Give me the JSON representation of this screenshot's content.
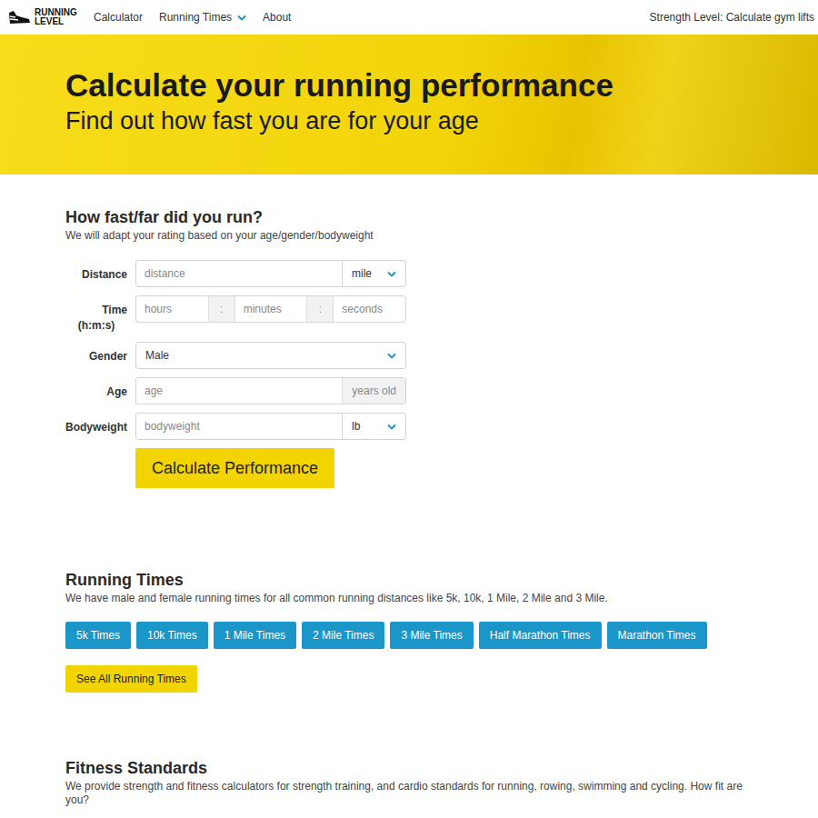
{
  "nav": {
    "logo": {
      "line1": "RUNNING",
      "line2": "LEVEL"
    },
    "links": [
      {
        "label": "Calculator",
        "dropdown": false
      },
      {
        "label": "Running Times",
        "dropdown": true
      },
      {
        "label": "About",
        "dropdown": false
      }
    ],
    "right_link": "Strength Level: Calculate gym lifts"
  },
  "hero": {
    "title": "Calculate your running performance",
    "subtitle": "Find out how fast you are for your age"
  },
  "calculator": {
    "title": "How fast/far did you run?",
    "subtitle": "We will adapt your rating based on your age/gender/bodyweight",
    "fields": [
      {
        "kind": "unit",
        "label": "Distance",
        "placeholder": "distance",
        "unit": "mile"
      },
      {
        "kind": "time",
        "label": "Time",
        "sublabel": "(h:m:s)",
        "parts": [
          "hours",
          "minutes",
          "seconds"
        ],
        "separator": ":"
      },
      {
        "kind": "select",
        "label": "Gender",
        "value": "Male"
      },
      {
        "kind": "addon",
        "label": "Age",
        "placeholder": "age",
        "addon": "years old"
      },
      {
        "kind": "unit",
        "label": "Bodyweight",
        "placeholder": "bodyweight",
        "unit": "lb"
      }
    ],
    "button": "Calculate Performance"
  },
  "running_times": {
    "title": "Running Times",
    "description": "We have male and female running times for all common running distances like 5k, 10k, 1 Mile, 2 Mile and 3 Mile.",
    "buttons": [
      "5k Times",
      "10k Times",
      "1 Mile Times",
      "2 Mile Times",
      "3 Mile Times",
      "Half Marathon Times",
      "Marathon Times"
    ],
    "see_all": "See All Running Times"
  },
  "fitness": {
    "title": "Fitness Standards",
    "description": "We provide strength and fitness calculators for strength training, and cardio standards for running, rowing, swimming and cycling. How fit are you?"
  }
}
